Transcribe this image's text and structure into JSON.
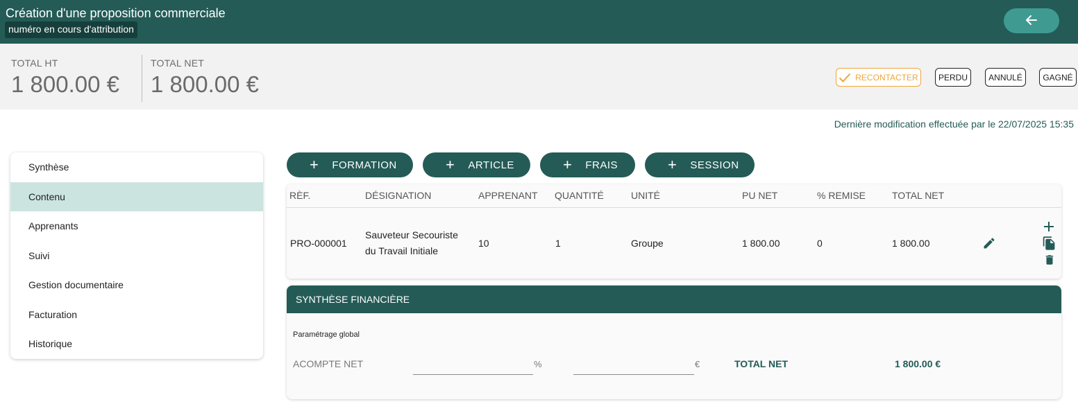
{
  "header": {
    "title": "Création d'une proposition commerciale",
    "subtitle": "numéro en cours d'attribution"
  },
  "totals": {
    "ht_label": "TOTAL HT",
    "ht_value": "1 800.00 €",
    "net_label": "TOTAL NET",
    "net_value": "1 800.00 €"
  },
  "status_buttons": {
    "recontacter": "RECONTACTER",
    "perdu": "PERDU",
    "annule": "ANNULÉ",
    "gagne": "GAGNÉ"
  },
  "last_modified": "Dernière modification effectuée par le 22/07/2025 15:35",
  "sidebar": {
    "items": [
      {
        "label": "Synthèse"
      },
      {
        "label": "Contenu"
      },
      {
        "label": "Apprenants"
      },
      {
        "label": "Suivi"
      },
      {
        "label": "Gestion documentaire"
      },
      {
        "label": "Facturation"
      },
      {
        "label": "Historique"
      }
    ],
    "active": "Contenu"
  },
  "toolbar": {
    "formation": "FORMATION",
    "article": "ARTICLE",
    "frais": "FRAIS",
    "session": "SESSION"
  },
  "table": {
    "columns": [
      "RÈF.",
      "DÉSIGNATION",
      "APPRENANT",
      "QUANTITÉ",
      "UNITÉ",
      "PU NET",
      "% REMISE",
      "TOTAL NET"
    ],
    "rows": [
      {
        "ref": "PRO-000001",
        "designation_line1": "Sauveteur Secouriste",
        "designation_line2": "du Travail Initiale",
        "apprenant": "10",
        "quantite": "1",
        "unite": "Groupe",
        "pu_net": "1 800.00",
        "remise": "0",
        "total_net": "1 800.00"
      }
    ]
  },
  "financial": {
    "title": "SYNTHÈSE FINANCIÈRE",
    "param_label": "Paramétrage global",
    "acompte_label": "ACOMPTE NET",
    "percent_value": "",
    "percent_unit": "%",
    "euro_value": "",
    "euro_unit": "€",
    "total_label": "TOTAL NET",
    "total_value": "1 800.00 €"
  },
  "colors": {
    "primary": "#245b56",
    "accent": "#3f9a92",
    "active_nav": "#cce4e0",
    "warning": "#f0a53a"
  },
  "icons": [
    "arrow-left-icon",
    "check-icon",
    "plus-icon",
    "pencil-icon",
    "copy-icon",
    "trash-icon"
  ]
}
